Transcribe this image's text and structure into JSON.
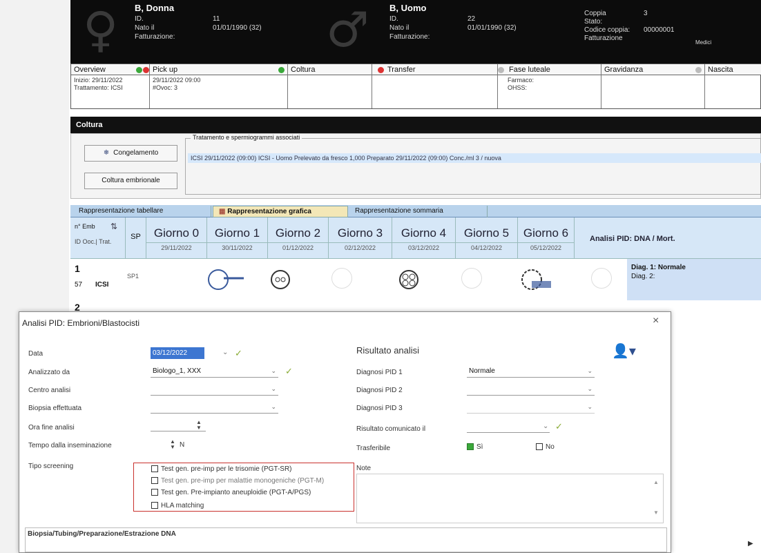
{
  "header": {
    "woman": {
      "name": "B, Donna",
      "id_label": "ID.",
      "id": "11",
      "birth_label": "Nato il",
      "birth": "01/01/1990 (32)",
      "fatt_label": "Fatturazione:"
    },
    "man": {
      "name": "B, Uomo",
      "id_label": "ID.",
      "id": "22",
      "birth_label": "Nato il",
      "birth": "01/01/1990 (32)",
      "fatt_label": "Fatturazione:"
    },
    "right": {
      "line1_label": "Coppia",
      "line1_value": "3",
      "line2_label": "Stato:",
      "line3_label": "Codice coppia:",
      "line3_value": "00000001",
      "line4_label": "Fatturazione",
      "line4_small": "Medici"
    }
  },
  "steps": [
    {
      "label": "Overview",
      "body": [
        "Inizio: 29/11/2022",
        "Trattamento: ICSI"
      ],
      "dots": [
        "green",
        "red"
      ]
    },
    {
      "label": "Pick up",
      "body": [
        "29/11/2022 09:00",
        "#Ovoc: 3"
      ],
      "dots": [
        "green"
      ]
    },
    {
      "label": "Coltura",
      "body": [],
      "dots": []
    },
    {
      "label": "Transfer",
      "body": [],
      "dots": [
        "red"
      ]
    },
    {
      "label": "Fase luteale",
      "body": [
        "Farmaco:",
        "OHSS:"
      ],
      "dots": [
        "gray"
      ]
    },
    {
      "label": "Gravidanza",
      "body": [],
      "dots": [
        "gray"
      ]
    },
    {
      "label": "Nascita",
      "body": [],
      "dots": []
    }
  ],
  "coltura": {
    "title": "Coltura",
    "btn_congelamento": "Congelamento",
    "btn_coltura": "Coltura embrionale",
    "legend": "Tratamento e spermiogrammi associati",
    "row": "ICSI   29/11/2022 (09:00)   ICSI - Uomo   Prelevato da fresco   1,000      Preparato 29/11/2022 (09:00)   Conc./ml   3 / nuova"
  },
  "tabs": [
    "Rappresentazione tabellare",
    "Rappresentazione grafica",
    "Rappresentazione sommaria"
  ],
  "grid": {
    "col1a": "n° Emb",
    "col1b": "ID Ooc.| Trat.",
    "sp": "SP",
    "days": [
      {
        "label": "Giorno 0",
        "date": "29/11/2022"
      },
      {
        "label": "Giorno 1",
        "date": "30/11/2022"
      },
      {
        "label": "Giorno 2",
        "date": "01/12/2022"
      },
      {
        "label": "Giorno 3",
        "date": "02/12/2022"
      },
      {
        "label": "Giorno 4",
        "date": "03/12/2022"
      },
      {
        "label": "Giorno 5",
        "date": "04/12/2022"
      },
      {
        "label": "Giorno 6",
        "date": "05/12/2022"
      }
    ],
    "analysis": "Analisi PID: DNA / Mort.",
    "row1": {
      "num": "1",
      "sub": "57",
      "tag": "ICSI",
      "sp": "SP1",
      "diag1": "Diag. 1: Normale",
      "diag2": "Diag. 2:"
    },
    "row2": {
      "num": "2"
    }
  },
  "dialog": {
    "title": "Analisi PID: Embrioni/Blastocisti",
    "close": "×",
    "left": {
      "data_label": "Data",
      "data_value": "03/12/2022",
      "analizzato_label": "Analizzato da",
      "analizzato_value": "Biologo_1, XXX",
      "centro_label": "Centro analisi",
      "biopsia_label": "Biopsia effettuata",
      "ora_label": "Ora fine analisi",
      "tempo_label": "Tempo dalla inseminazione",
      "tempo_value": "N",
      "tipo_label": "Tipo screening",
      "checks": [
        "Test gen. pre-imp per le trisomie (PGT-SR)",
        "Test gen. pre-imp per malattie monogeniche (PGT-M)",
        "Test gen. Pre-impianto aneuploidie (PGT-A/PGS)",
        "HLA matching"
      ],
      "biopsia_footer": "Biopsia/Tubing/Preparazione/Estrazione DNA"
    },
    "right": {
      "title": "Risultato analisi",
      "d1_label": "Diagnosi PID 1",
      "d1_value": "Normale",
      "d2_label": "Diagnosi PID 2",
      "d3_label": "Diagnosi PID 3",
      "ris_label": "Risultato comunicato il",
      "trans_label": "Trasferibile",
      "yes": "Sì",
      "no": "No",
      "note_label": "Note"
    }
  },
  "colors": {
    "header_bg": "#0c0c0c",
    "tab_active": "#f3e7b7",
    "row_highlight": "#cfe0f5",
    "checkbox_group_border": "#c9302c"
  }
}
